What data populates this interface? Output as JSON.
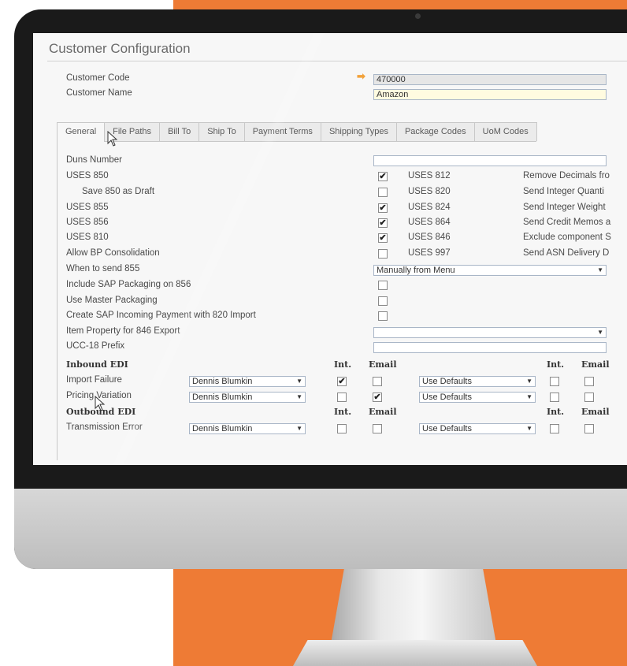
{
  "window": {
    "title": "Customer Configuration"
  },
  "header": {
    "customer_code_label": "Customer Code",
    "customer_code_value": "470000",
    "customer_name_label": "Customer Name",
    "customer_name_value": "Amazon"
  },
  "tabs": [
    "General",
    "File Paths",
    "Bill To",
    "Ship To",
    "Payment Terms",
    "Shipping Types",
    "Package Codes",
    "UoM Codes"
  ],
  "general": {
    "left_labels": {
      "duns": "Duns Number",
      "uses850": "USES 850",
      "save850": "Save 850 as Draft",
      "uses855": "USES 855",
      "uses856": "USES 856",
      "uses810": "USES 810",
      "allow_bp": "Allow BP Consolidation",
      "when855": "When to send 855",
      "include_sap": "Include SAP Packaging on 856",
      "use_master": "Use Master Packaging",
      "create_sap": "Create SAP Incoming Payment with 820 Import",
      "item_prop": "Item Property for 846 Export",
      "ucc18": "UCC-18 Prefix"
    },
    "uses_rows": [
      {
        "code": "USES 812",
        "checked": true,
        "desc": "Remove Decimals fro"
      },
      {
        "code": "USES 820",
        "checked": false,
        "desc": "Send Integer Quanti"
      },
      {
        "code": "USES 824",
        "checked": true,
        "desc": "Send Integer Weight"
      },
      {
        "code": "USES 864",
        "checked": true,
        "desc": "Send Credit Memos a"
      },
      {
        "code": "USES 846",
        "checked": true,
        "desc": "Exclude component S"
      },
      {
        "code": "USES 997",
        "checked": false,
        "desc": "Send ASN Delivery D"
      }
    ],
    "when855_value": "Manually from Menu"
  },
  "edi": {
    "inbound_header": "Inbound EDI",
    "outbound_header": "Outbound EDI",
    "int_label": "Int.",
    "email_label": "Email",
    "rows": {
      "import_failure": {
        "label": "Import Failure",
        "user": "Dennis Blumkin",
        "defaults": "Use Defaults"
      },
      "pricing_variation": {
        "label": "Pricing Variation",
        "user": "Dennis Blumkin",
        "defaults": "Use Defaults"
      },
      "transmission_error": {
        "label": "Transmission Error",
        "user": "Dennis Blumkin",
        "defaults": "Use Defaults"
      }
    }
  },
  "glyphs": {
    "check": "✔",
    "caret": "▼",
    "arrow": "➡"
  }
}
